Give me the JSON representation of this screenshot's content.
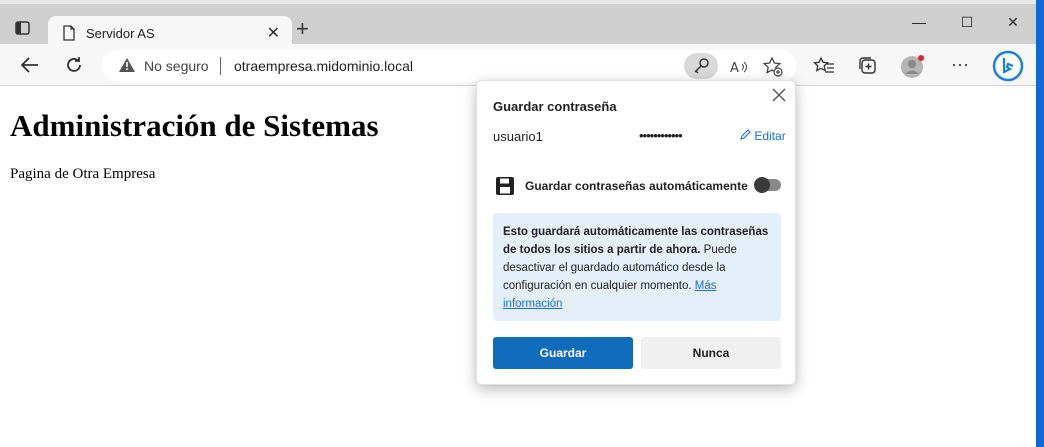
{
  "tab": {
    "title": "Servidor AS",
    "close_glyph": "✕",
    "new_tab_glyph": "+"
  },
  "window_controls": {
    "minimize": "—",
    "maximize": "☐",
    "close": "✕"
  },
  "address_bar": {
    "security_label": "No seguro",
    "url": "otraempresa.midominio.local"
  },
  "page": {
    "heading": "Administración de Sistemas",
    "text": "Pagina de Otra Empresa"
  },
  "popup": {
    "title": "Guardar contraseña",
    "username": "usuario1",
    "password_mask": "••••••••••••",
    "edit_label": "Editar",
    "auto_save_label": "Guardar contraseñas automáticamente",
    "auto_save_enabled": false,
    "info_bold": "Esto guardará automáticamente las contraseñas de todos los sitios a partir de ahora.",
    "info_text": " Puede desactivar el guardado automático desde la configuración en cualquier momento.",
    "info_link": "Más información",
    "save_button": "Guardar",
    "never_button": "Nunca"
  },
  "colors": {
    "accent": "#0f6cbd",
    "info_bg": "#e4eff9",
    "desktop": "#1f6fd6"
  }
}
